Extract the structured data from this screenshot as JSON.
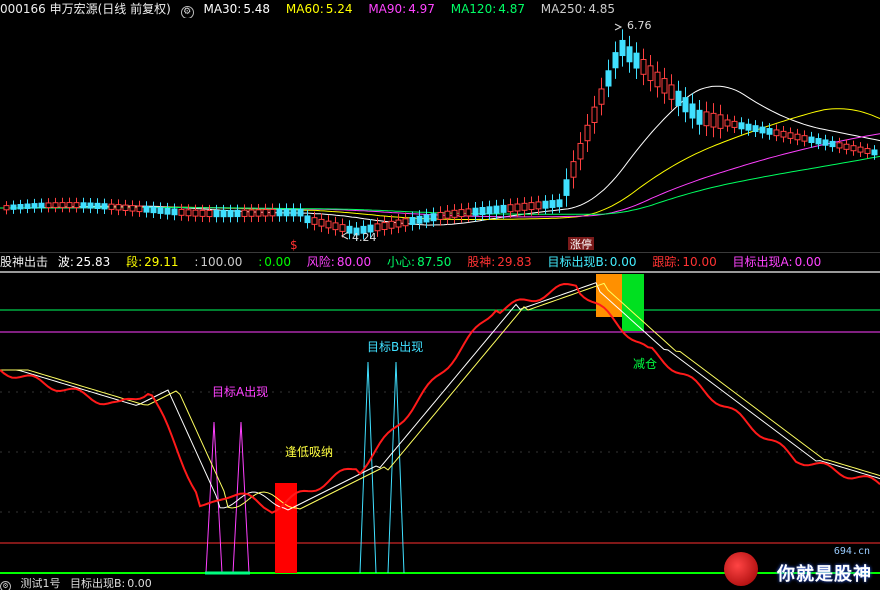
{
  "top_bar": {
    "title": "000166 申万宏源(日线 前复权)",
    "ma": [
      {
        "label": "MA30:",
        "value": "5.48",
        "color": "#ffffff"
      },
      {
        "label": "MA60:",
        "value": "5.24",
        "color": "#ffff00"
      },
      {
        "label": "MA90:",
        "value": "4.97",
        "color": "#ff40ff"
      },
      {
        "label": "MA120:",
        "value": "4.87",
        "color": "#00ff60"
      },
      {
        "label": "MA250:",
        "value": "4.85",
        "color": "#cccccc"
      }
    ]
  },
  "main_chart": {
    "high_label": "6.76",
    "low_label": "4.24",
    "marker_s": "$",
    "marker_zt": "涨停"
  },
  "indicator_bar": {
    "name": "股神出击",
    "fields": [
      {
        "label": "波:",
        "value": "25.83",
        "color": "#ffffff"
      },
      {
        "label": "段:",
        "value": "29.11",
        "color": "#ffff00"
      },
      {
        "label": ":",
        "value": "100.00",
        "color": "#cccccc"
      },
      {
        "label": ":",
        "value": "0.00",
        "color": "#00ff00"
      },
      {
        "label": "风险:",
        "value": "80.00",
        "color": "#ff40ff"
      },
      {
        "label": "小心:",
        "value": "87.50",
        "color": "#00ff60"
      },
      {
        "label": "股神:",
        "value": "29.83",
        "color": "#ff3030"
      },
      {
        "label": "目标出现B:",
        "value": "0.00",
        "color": "#40e0ff"
      },
      {
        "label": "跟踪:",
        "value": "10.00",
        "color": "#ff3030"
      },
      {
        "label": "目标出现A:",
        "value": "0.00",
        "color": "#ff40ff"
      }
    ]
  },
  "indicator_chart": {
    "label_a": "目标A出现",
    "label_b": "目标B出现",
    "label_low": "逢低吸纳",
    "label_reduce": "减仓"
  },
  "bottom_bar": {
    "name": "测试1号",
    "field_label": "目标出现B:",
    "field_value": "0.00"
  },
  "watermark": {
    "site": "694.cn",
    "name": "你就是股神"
  }
}
